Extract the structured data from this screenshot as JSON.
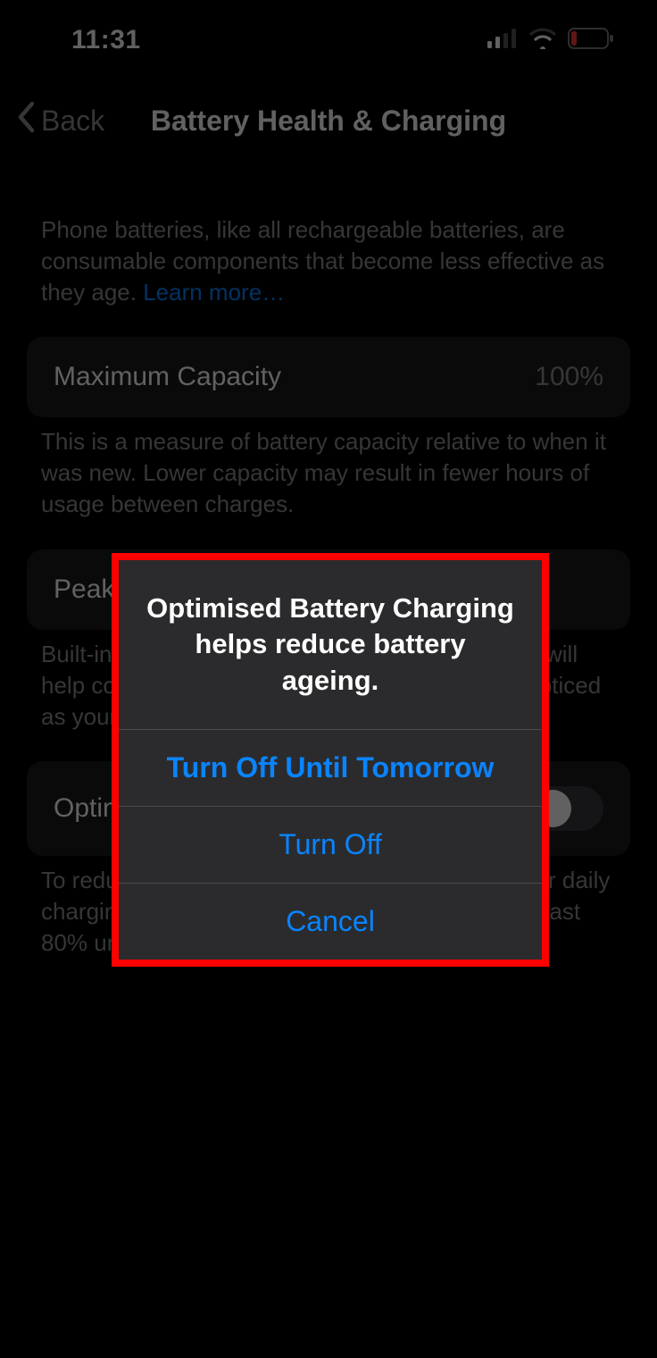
{
  "status": {
    "time": "11:31"
  },
  "nav": {
    "back": "Back",
    "title": "Battery Health & Charging"
  },
  "intro": {
    "text": "Phone batteries, like all rechargeable batteries, are consumable components that become less effective as they age. ",
    "learn_more": "Learn more…"
  },
  "capacity": {
    "label": "Maximum Capacity",
    "value": "100%",
    "footer": "This is a measure of battery capacity relative to when it was new. Lower capacity may result in fewer hours of usage between charges."
  },
  "peak": {
    "label": "Peak Performance Capability",
    "footer": "Built-in dynamic software and hardware systems will help counter performance impacts that may be noticed as your iPhone battery chemically ages."
  },
  "optimised": {
    "label": "Optimised Battery Charging",
    "footer": "To reduce battery ageing, iPhone learns from your daily charging routine so it can wait to finish charging past 80% until you need to use it."
  },
  "alert": {
    "title": "Optimised Battery Charging helps reduce battery ageing.",
    "option1": "Turn Off Until Tomorrow",
    "option2": "Turn Off",
    "cancel": "Cancel"
  }
}
